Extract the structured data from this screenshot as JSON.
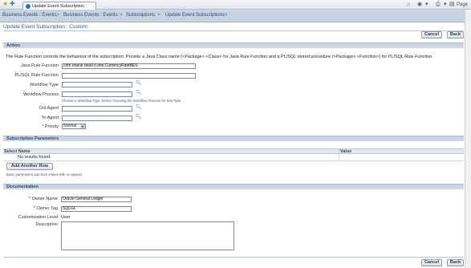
{
  "browser": {
    "tab_title": "Update Event Subscription : Custom",
    "tools": {
      "page_label": "Page"
    }
  },
  "breadcrumbs": [
    "Business Events : Events",
    "Business Events : Events",
    "Subscriptions",
    "Update Event Subscriptions"
  ],
  "breadcrumb_separator": ">",
  "page_title": "Update Event Subscription : Custom",
  "buttons": {
    "cancel": "Cancel",
    "back": "Back"
  },
  "action": {
    "section_title": "Action",
    "description": "The Rule Function controls the behaviour of the subscription. Provide a Java Class name (<Package>.<Class> for Java Rule Function and a PL/SQL stored procedure (<Package>.<Function>) for PL/SQL Rule Function.",
    "fields": {
      "java_rule_function": {
        "label": "Java Rule Function",
        "value": "com.oracle.retail.rl.ebs.CurrencyRateBES"
      },
      "plsql_rule_function": {
        "label": "PL/SQL Rule Function",
        "value": ""
      },
      "workflow_type": {
        "label": "Workflow Type",
        "value": ""
      },
      "workflow_process": {
        "label": "Workflow Process",
        "value": "",
        "hint": "Choose a Workflow Type, before choosing the Workflow Process for that Type"
      },
      "out_agent": {
        "label": "Out Agent",
        "value": ""
      },
      "to_agent": {
        "label": "To Agent",
        "value": ""
      },
      "priority": {
        "label": "Priority",
        "value": "Normal"
      }
    }
  },
  "subscription_parameters": {
    "section_title": "Subscription Parameters",
    "columns": [
      "Select Name",
      "Value"
    ],
    "empty_text": "No results found.",
    "add_row_label": "Add Another Row",
    "hint": "Enter parameters and their values with no spaces"
  },
  "documentation": {
    "section_title": "Documentation",
    "owner_name": {
      "label": "Owner Name",
      "value": "Oracle General Ledger"
    },
    "owner_tag": {
      "label": "Owner Tag",
      "value": "SQLGL"
    },
    "customization_level": {
      "label": "Customization Level",
      "value": "User"
    },
    "description": {
      "label": "Description",
      "value": ""
    }
  },
  "required_marker": "*",
  "icons": {
    "lov": "search-icon",
    "favorites": "star-icon"
  },
  "colors": {
    "header_bg": "#c6d3e3",
    "section_bg": "#c9d6e6",
    "title_text": "#30568c"
  }
}
